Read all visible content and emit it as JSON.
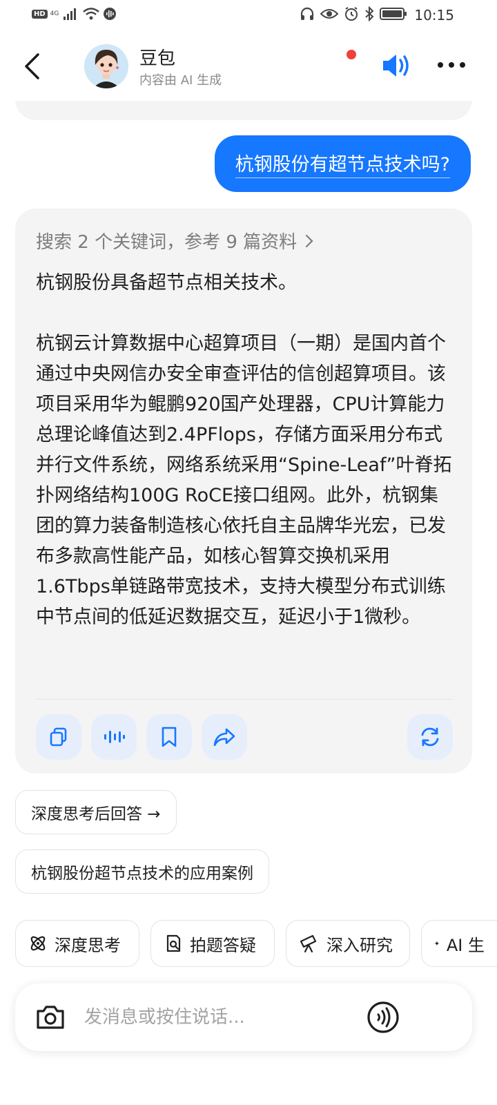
{
  "status_bar": {
    "hd": "HD",
    "network": "4G",
    "time": "10:15"
  },
  "header": {
    "bot_name": "豆包",
    "subtitle": "内容由 AI 生成"
  },
  "conversation": {
    "user_message": "杭钢股份有超节点技术吗?",
    "answer": {
      "search_summary": "搜索 2 个关键词，参考 9 篇资料",
      "paragraph_1": "杭钢股份具备超节点相关技术。",
      "paragraph_2": "杭钢云计算数据中心超算项目（一期）是国内首个通过中央网信办安全审查评估的信创超算项目。该项目采用华为鲲鹏920国产处理器，CPU计算能力总理论峰值达到2.4PFlops，存储方面采用分布式并行文件系统，网络系统采用“Spine-Leaf”叶脊拓扑网络结构100G RoCE接口组网。此外，杭钢集团的算力装备制造核心依托自主品牌华光宏，已发布多款高性能产品，如核心智算交换机采用1.6Tbps单链路带宽技术，支持大模型分布式训练中节点间的低延迟数据交互，延迟小于1微秒。",
      "actions": [
        "copy-icon",
        "read-aloud-icon",
        "bookmark-icon",
        "share-icon",
        "regenerate-icon"
      ]
    }
  },
  "suggestions": {
    "deep_think_answer": "深度思考后回答 →",
    "followup": "杭钢股份超节点技术的应用案例"
  },
  "tools": [
    {
      "label": "深度思考",
      "icon": "atom-icon"
    },
    {
      "label": "拍题答疑",
      "icon": "photo-question-icon"
    },
    {
      "label": "深入研究",
      "icon": "telescope-icon"
    },
    {
      "label": "AI 生",
      "icon": "sparkle-icon"
    }
  ],
  "input": {
    "placeholder": "发消息或按住说话..."
  },
  "colors": {
    "accent": "#1677ff",
    "card_bg": "#f4f4f5",
    "notification_dot": "#f0403c"
  }
}
